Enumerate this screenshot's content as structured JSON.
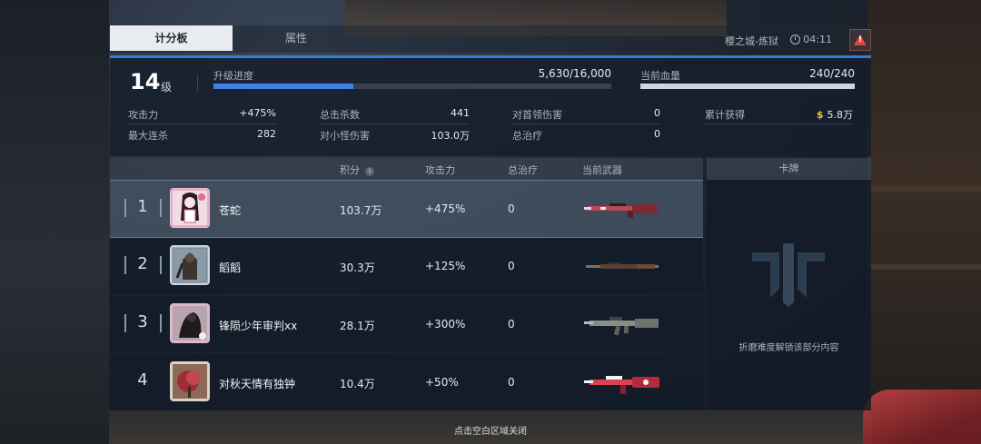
{
  "tabs": [
    {
      "label": "计分板",
      "active": true
    },
    {
      "label": "属性",
      "active": false
    }
  ],
  "header": {
    "location": "樱之城-炼狱",
    "time": "04:11"
  },
  "level": {
    "number": "14",
    "unit": "级"
  },
  "exp": {
    "label": "升级进度",
    "value": "5,630/16,000",
    "progress": 0.352
  },
  "hp": {
    "label": "当前血量",
    "value": "240/240",
    "progress": 1.0
  },
  "stats": {
    "attack": {
      "label": "攻击力",
      "value": "+475%"
    },
    "max_streak": {
      "label": "最大连杀",
      "value": "282"
    },
    "total_kills": {
      "label": "总击杀数",
      "value": "441"
    },
    "minion_damage": {
      "label": "对小怪伤害",
      "value": "103.0万"
    },
    "boss_damage": {
      "label": "对首领伤害",
      "value": "0"
    },
    "total_heal": {
      "label": "总治疗",
      "value": "0"
    },
    "earned": {
      "label": "累计获得",
      "value": "5.8万",
      "icon": "dollar-icon"
    }
  },
  "table": {
    "headers": {
      "score": "积分",
      "attack": "攻击力",
      "heal": "总治疗",
      "weapon": "当前武器"
    },
    "rows": [
      {
        "rank": "1",
        "name": "苍蛇",
        "score": "103.7万",
        "attack": "+475%",
        "heal": "0",
        "selected": true
      },
      {
        "rank": "2",
        "name": "饀饀",
        "score": "30.3万",
        "attack": "+125%",
        "heal": "0",
        "selected": false
      },
      {
        "rank": "3",
        "name": "锋陨少年审判xx",
        "score": "28.1万",
        "attack": "+300%",
        "heal": "0",
        "selected": false
      },
      {
        "rank": "4",
        "name": "对秋天情有独钟",
        "score": "10.4万",
        "attack": "+50%",
        "heal": "0",
        "selected": false
      }
    ]
  },
  "cards": {
    "header": "卡牌",
    "locked_text": "折磨难度解锁该部分内容"
  },
  "footer": {
    "hint": "点击空白区域关闭"
  },
  "colors": {
    "accent": "#3e82e3",
    "gold": "#f3c13a",
    "warning": "#e0473a"
  }
}
